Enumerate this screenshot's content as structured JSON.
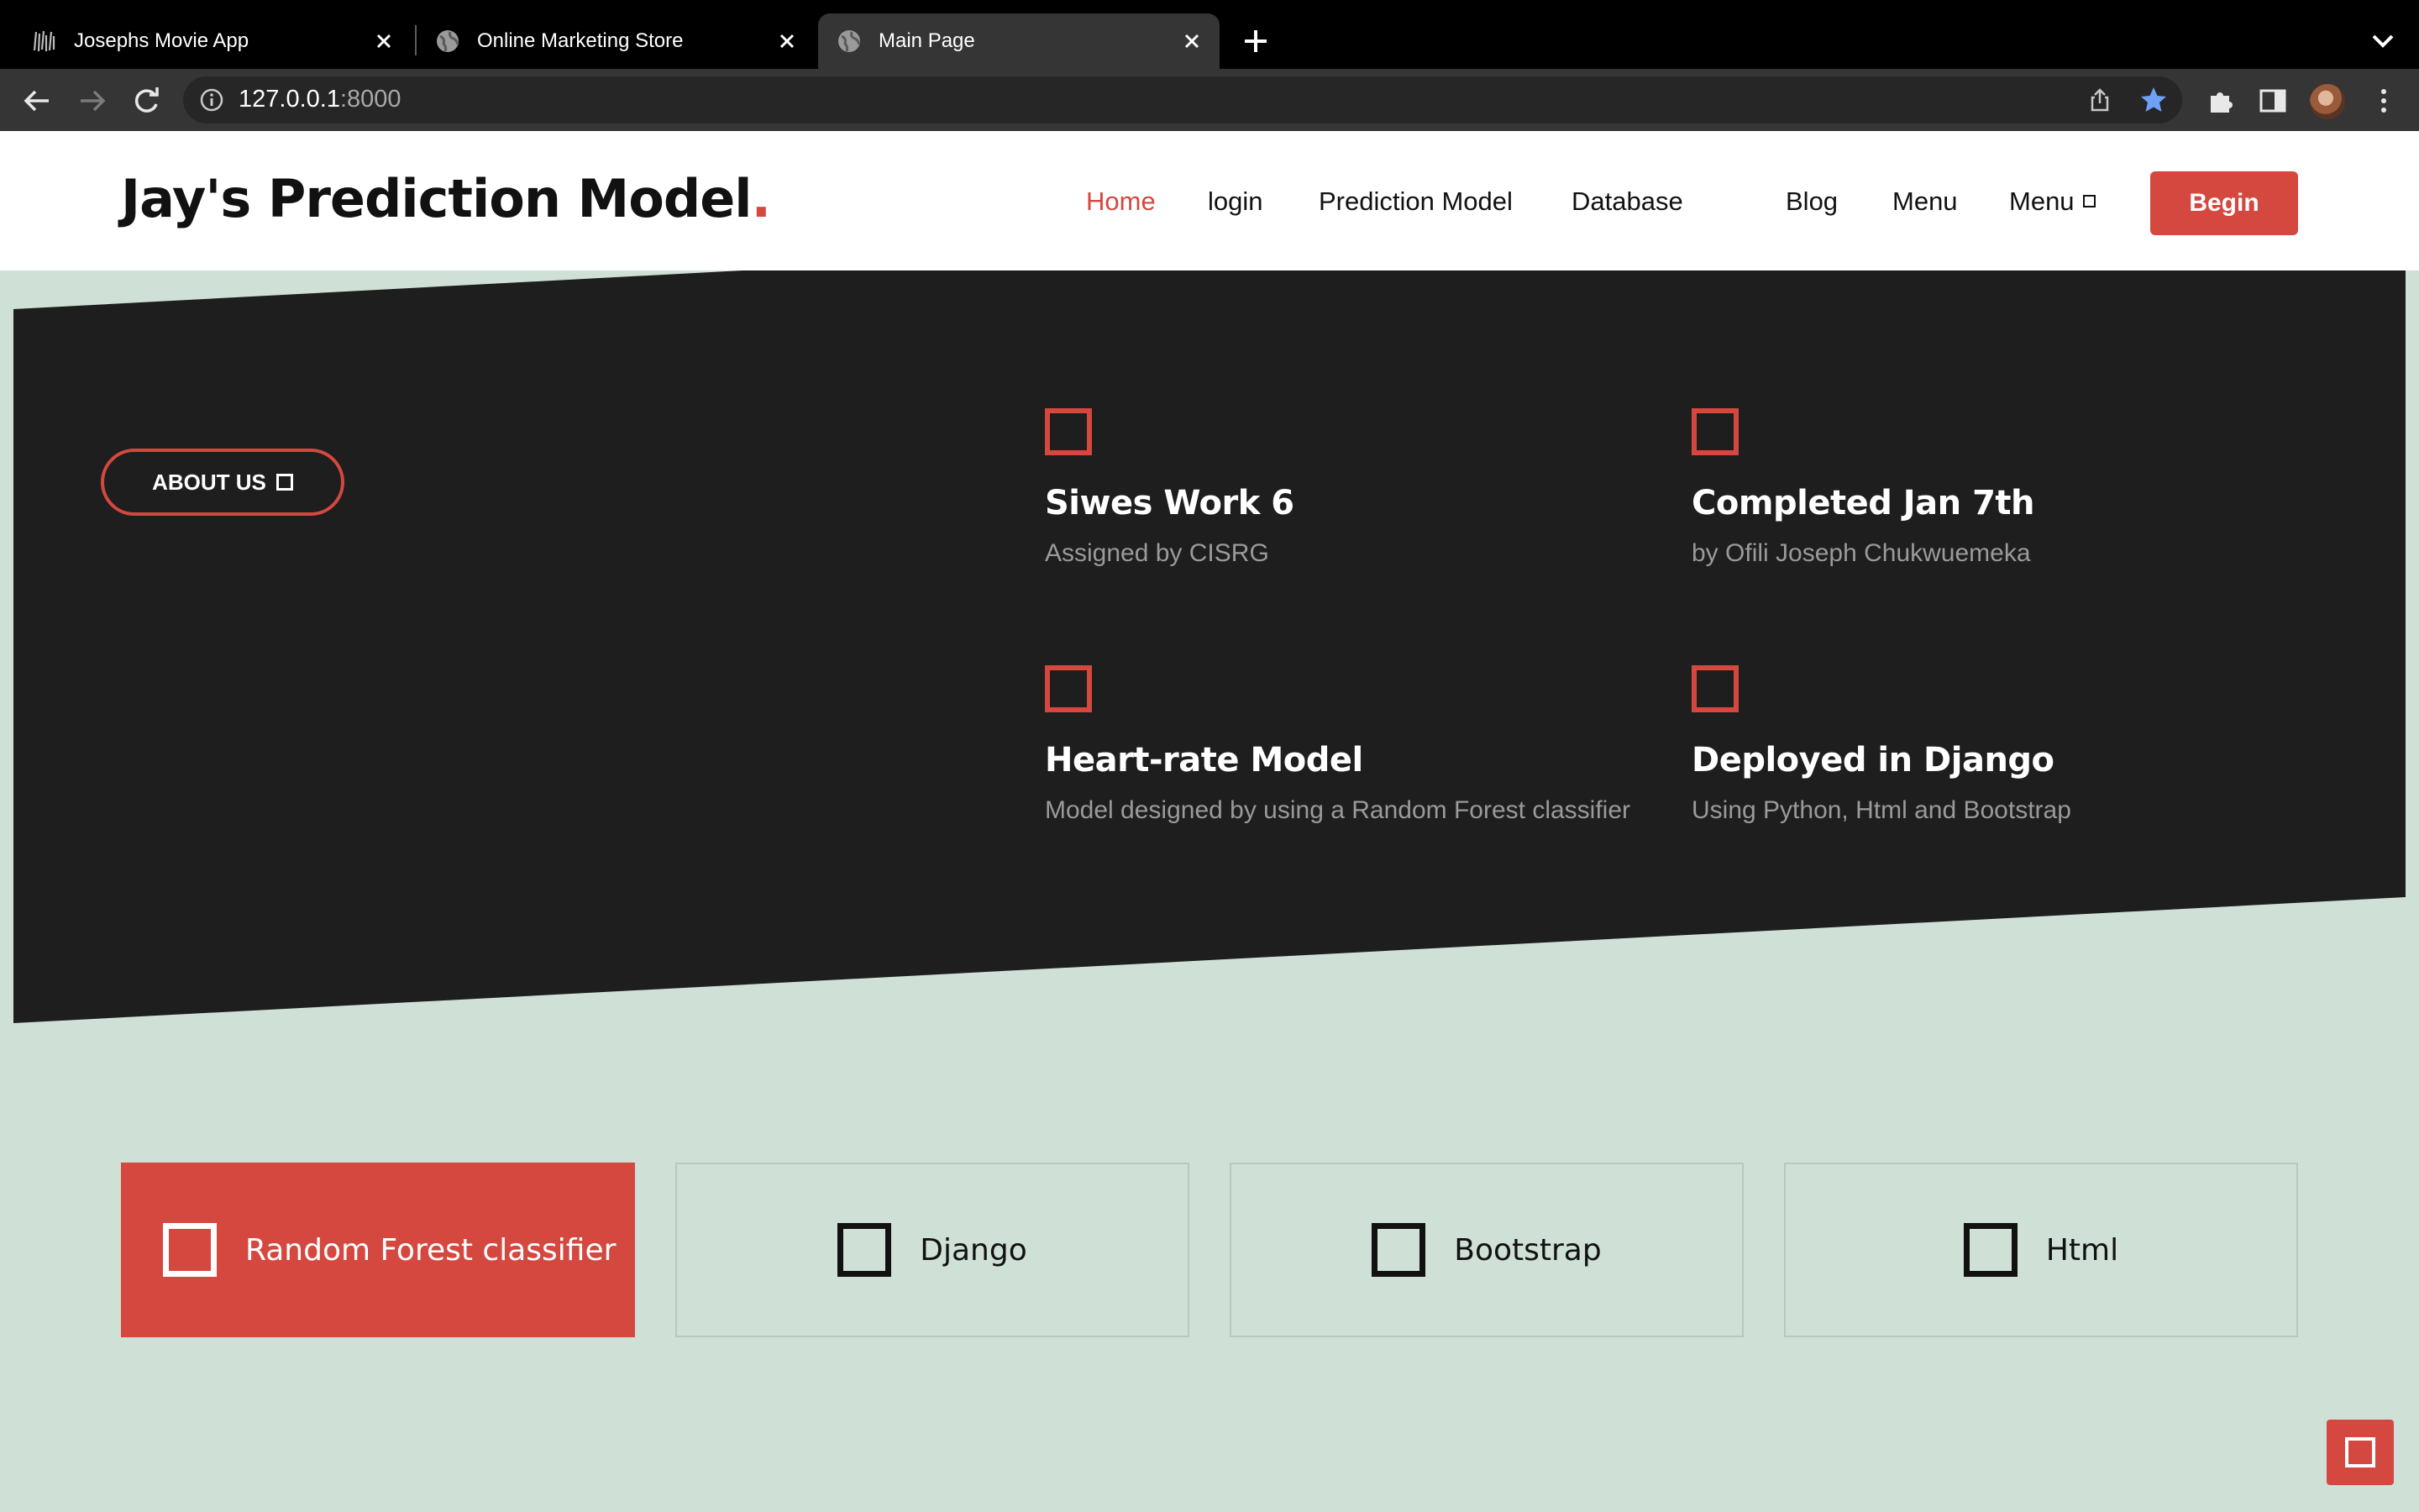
{
  "browser": {
    "tabs": [
      {
        "label": "Josephs Movie App",
        "favicon": "movie-favicon-icon",
        "active": false
      },
      {
        "label": "Online Marketing Store",
        "favicon": "globe-icon",
        "active": false
      },
      {
        "label": "Main Page",
        "favicon": "globe-icon",
        "active": true
      }
    ],
    "url_host": "127.0.0.1",
    "url_port": ":8000"
  },
  "header": {
    "brand": "Jay's Prediction Model",
    "brand_dot": ".",
    "nav": [
      "Home",
      "login",
      "Prediction Model",
      "Database",
      "Blog",
      "Menu",
      "Menu"
    ],
    "cta": "Begin"
  },
  "hero": {
    "about_button": "ABOUT US",
    "features": [
      {
        "title": "Siwes Work 6",
        "subtitle": "Assigned by CISRG"
      },
      {
        "title": "Completed Jan 7th",
        "subtitle": "by Ofili Joseph Chukwuemeka"
      },
      {
        "title": "Heart-rate Model",
        "subtitle": "Model designed by using a Random Forest classifier"
      },
      {
        "title": "Deployed in Django",
        "subtitle": "Using Python, Html and Bootstrap"
      }
    ]
  },
  "tech": [
    "Random Forest classifier",
    "Django",
    "Bootstrap",
    "Html"
  ],
  "colors": {
    "accent": "#d44840",
    "dark": "#1e1e1e",
    "page_bg": "#cfe1d6"
  }
}
